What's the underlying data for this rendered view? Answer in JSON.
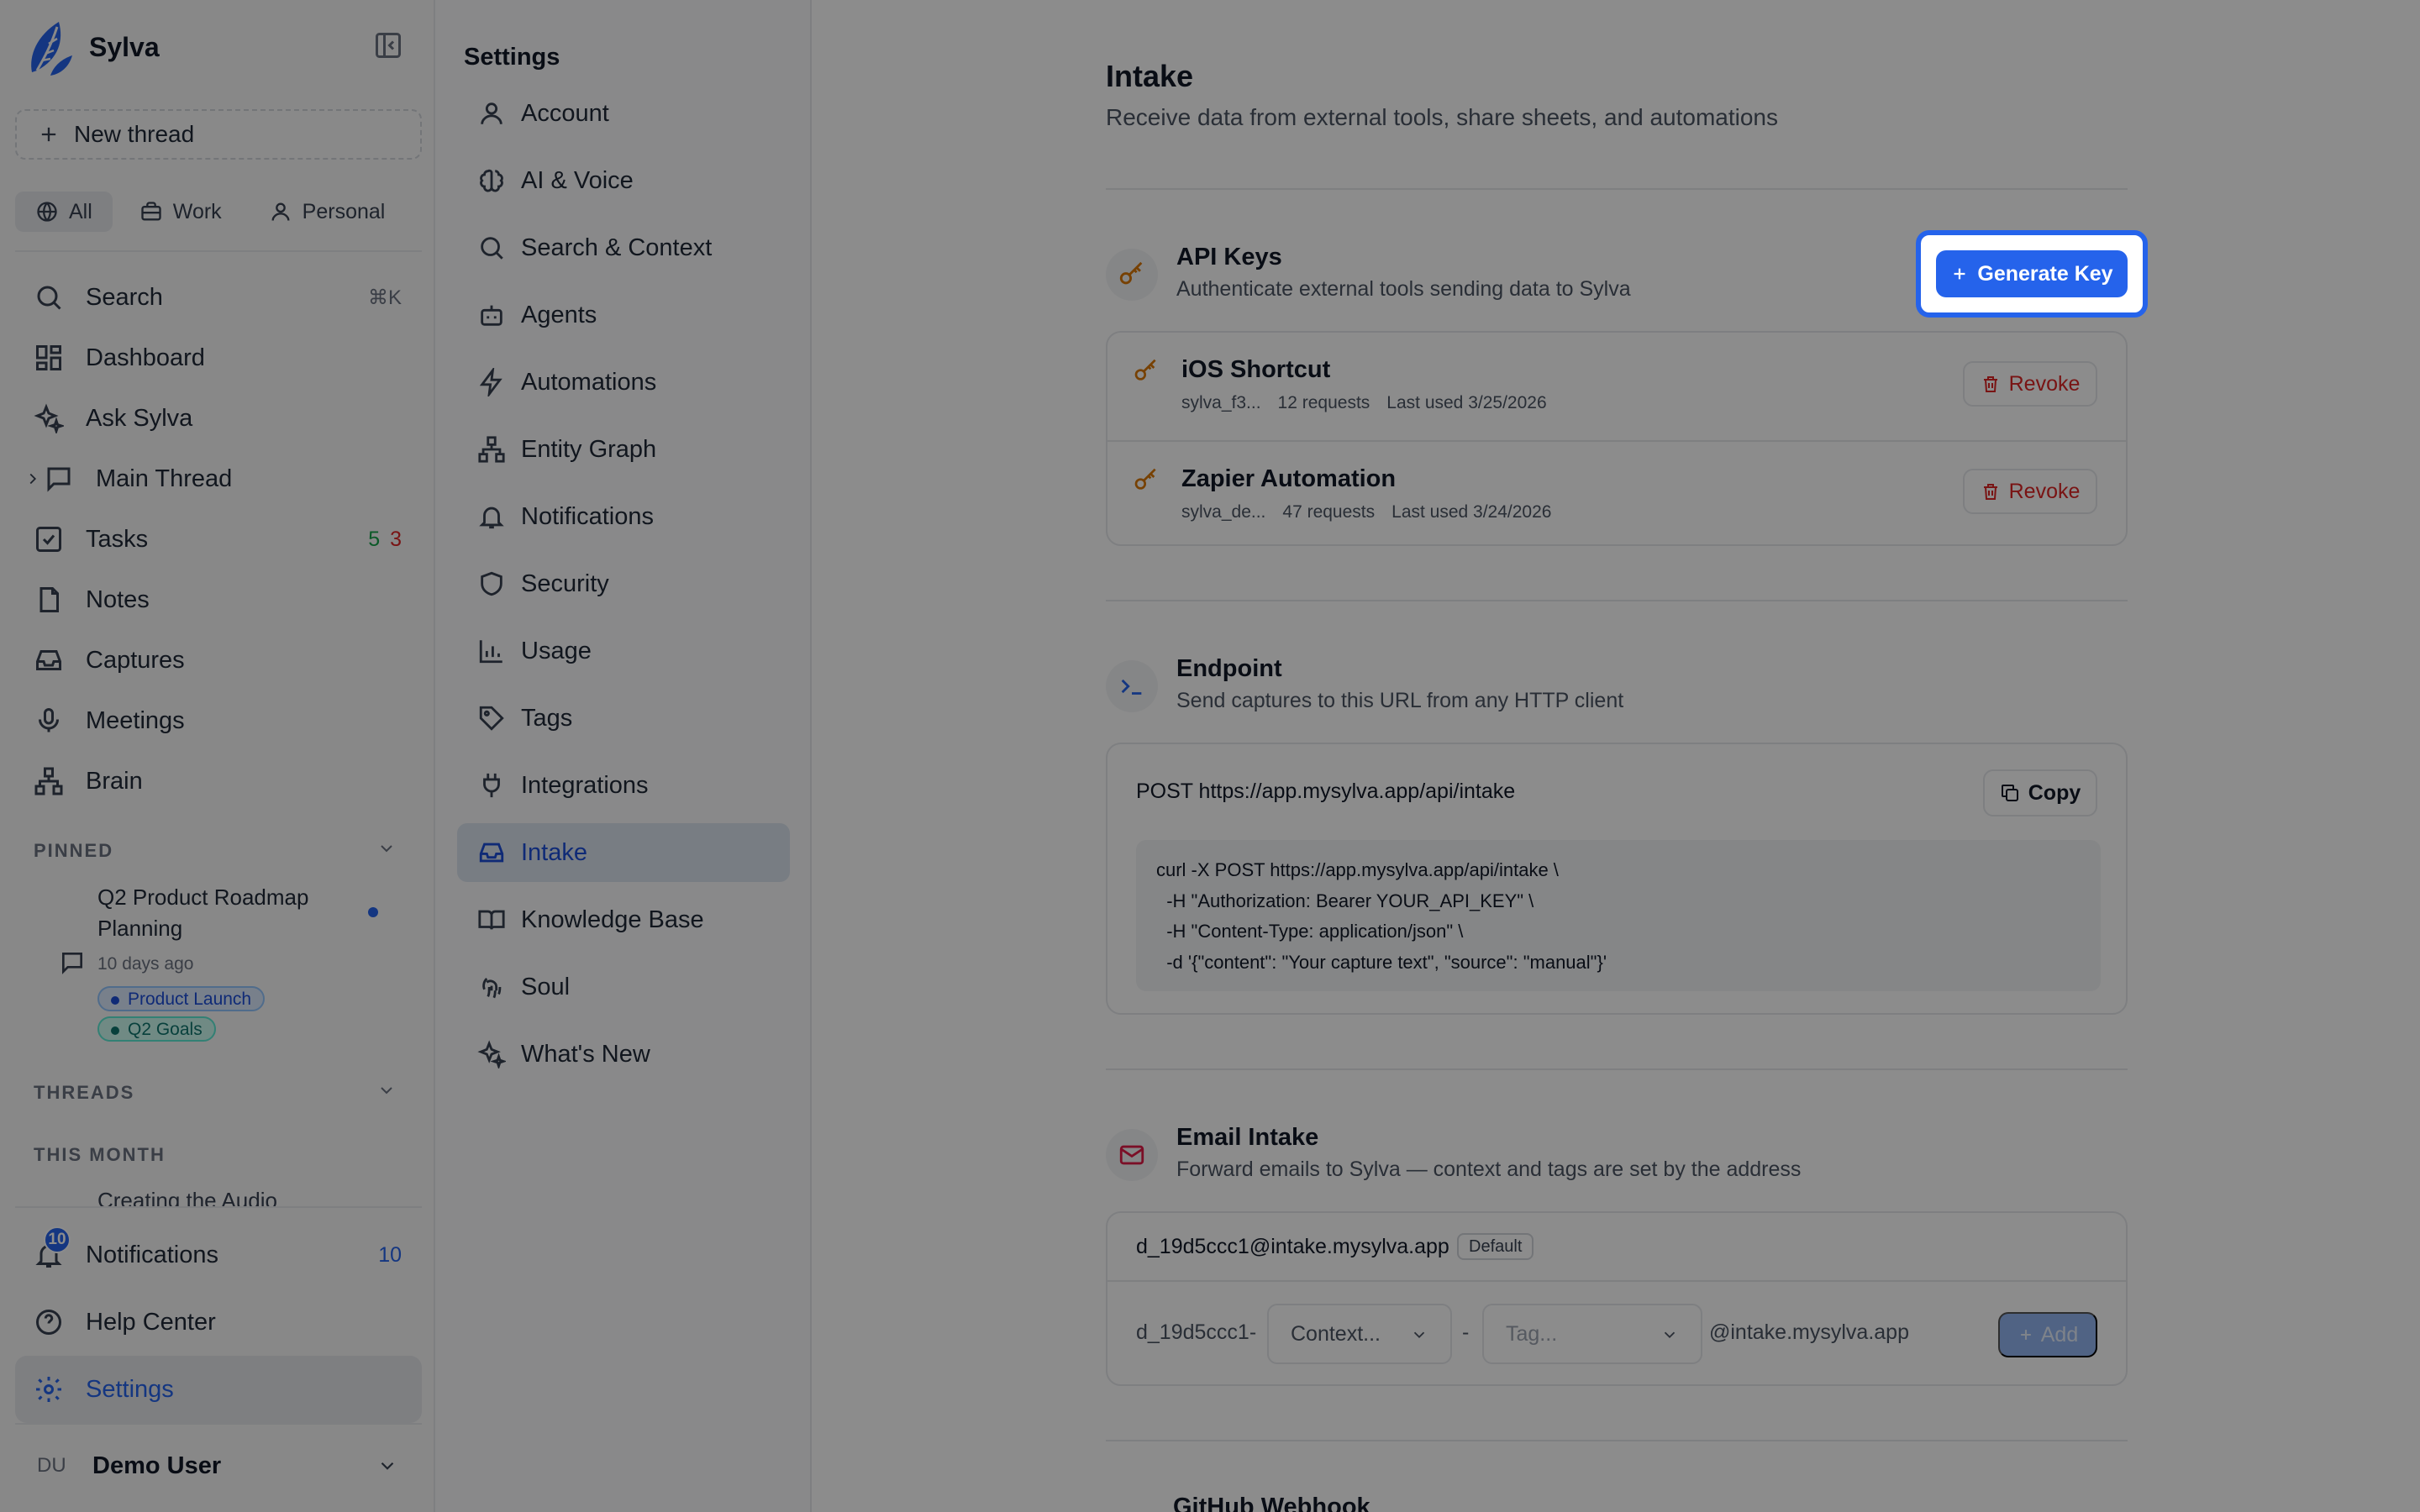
{
  "brand": {
    "name": "Sylva"
  },
  "sidebar": {
    "new_thread": "New thread",
    "scopes": [
      {
        "label": "All",
        "icon": "globe-icon"
      },
      {
        "label": "Work",
        "icon": "briefcase-icon"
      },
      {
        "label": "Personal",
        "icon": "user-icon"
      }
    ],
    "nav": [
      {
        "label": "Search",
        "shortcut": "⌘K",
        "icon": "search-icon"
      },
      {
        "label": "Dashboard",
        "icon": "dashboard-icon"
      },
      {
        "label": "Ask Sylva",
        "icon": "sparkles-icon"
      },
      {
        "label": "Main Thread",
        "icon": "message-icon"
      },
      {
        "label": "Tasks",
        "icon": "check-square-icon",
        "count_done": "5",
        "count_overdue": "3"
      },
      {
        "label": "Notes",
        "icon": "file-icon"
      },
      {
        "label": "Captures",
        "icon": "inbox-icon"
      },
      {
        "label": "Meetings",
        "icon": "mic-icon"
      },
      {
        "label": "Brain",
        "icon": "network-icon"
      }
    ],
    "pinned_label": "PINNED",
    "pinned": {
      "title": "Q2 Product Roadmap Planning",
      "time": "10 days ago",
      "tags": [
        "Product Launch",
        "Q2 Goals"
      ]
    },
    "threads_label": "THREADS",
    "month_label": "THIS MONTH",
    "month_item": "Creating the Audio",
    "bottom": [
      {
        "label": "Notifications",
        "badge": "10",
        "count": "10",
        "icon": "bell-icon"
      },
      {
        "label": "Help Center",
        "icon": "help-circle-icon"
      },
      {
        "label": "Settings",
        "icon": "gear-icon"
      }
    ],
    "user": {
      "initials": "DU",
      "name": "Demo User"
    }
  },
  "settings": {
    "title": "Settings",
    "items": [
      {
        "label": "Account",
        "icon": "user-icon"
      },
      {
        "label": "AI & Voice",
        "icon": "brain-icon"
      },
      {
        "label": "Search & Context",
        "icon": "search-icon"
      },
      {
        "label": "Agents",
        "icon": "bot-icon"
      },
      {
        "label": "Automations",
        "icon": "zap-icon"
      },
      {
        "label": "Entity Graph",
        "icon": "network-icon"
      },
      {
        "label": "Notifications",
        "icon": "bell-icon"
      },
      {
        "label": "Security",
        "icon": "shield-icon"
      },
      {
        "label": "Usage",
        "icon": "bar-chart-icon"
      },
      {
        "label": "Tags",
        "icon": "tag-icon"
      },
      {
        "label": "Integrations",
        "icon": "plug-icon"
      },
      {
        "label": "Intake",
        "icon": "inbox-icon"
      },
      {
        "label": "Knowledge Base",
        "icon": "book-icon"
      },
      {
        "label": "Soul",
        "icon": "fingerprint-icon"
      },
      {
        "label": "What's New",
        "icon": "sparkles-icon"
      }
    ]
  },
  "main": {
    "title": "Intake",
    "subtitle": "Receive data from external tools, share sheets, and automations",
    "api": {
      "title": "API Keys",
      "desc": "Authenticate external tools sending data to Sylva",
      "generate": "Generate Key",
      "revoke": "Revoke",
      "keys": [
        {
          "name": "iOS Shortcut",
          "prefix": "sylva_f3...",
          "requests": "12 requests",
          "last": "Last used 3/25/2026"
        },
        {
          "name": "Zapier Automation",
          "prefix": "sylva_de...",
          "requests": "47 requests",
          "last": "Last used 3/24/2026"
        }
      ]
    },
    "endpoint": {
      "title": "Endpoint",
      "desc": "Send captures to this URL from any HTTP client",
      "url": "POST https://app.mysylva.app/api/intake",
      "copy": "Copy",
      "code": "curl -X POST https://app.mysylva.app/api/intake \\\n  -H \"Authorization: Bearer YOUR_API_KEY\" \\\n  -H \"Content-Type: application/json\" \\\n  -d '{\"content\": \"Your capture text\", \"source\": \"manual\"}'"
    },
    "email": {
      "title": "Email Intake",
      "desc": "Forward emails to Sylva — context and tags are set by the address",
      "address": "d_19d5ccc1@intake.mysylva.app",
      "default_badge": "Default",
      "prefix": "d_19d5ccc1-",
      "context_placeholder": "Context...",
      "dash": "-",
      "tag_placeholder": "Tag...",
      "domain": "@intake.mysylva.app",
      "add": "Add"
    },
    "next_section": "GitHub Webhook"
  },
  "colors": {
    "accent": "#2563eb",
    "danger": "#dc2626",
    "key": "#d97706"
  }
}
